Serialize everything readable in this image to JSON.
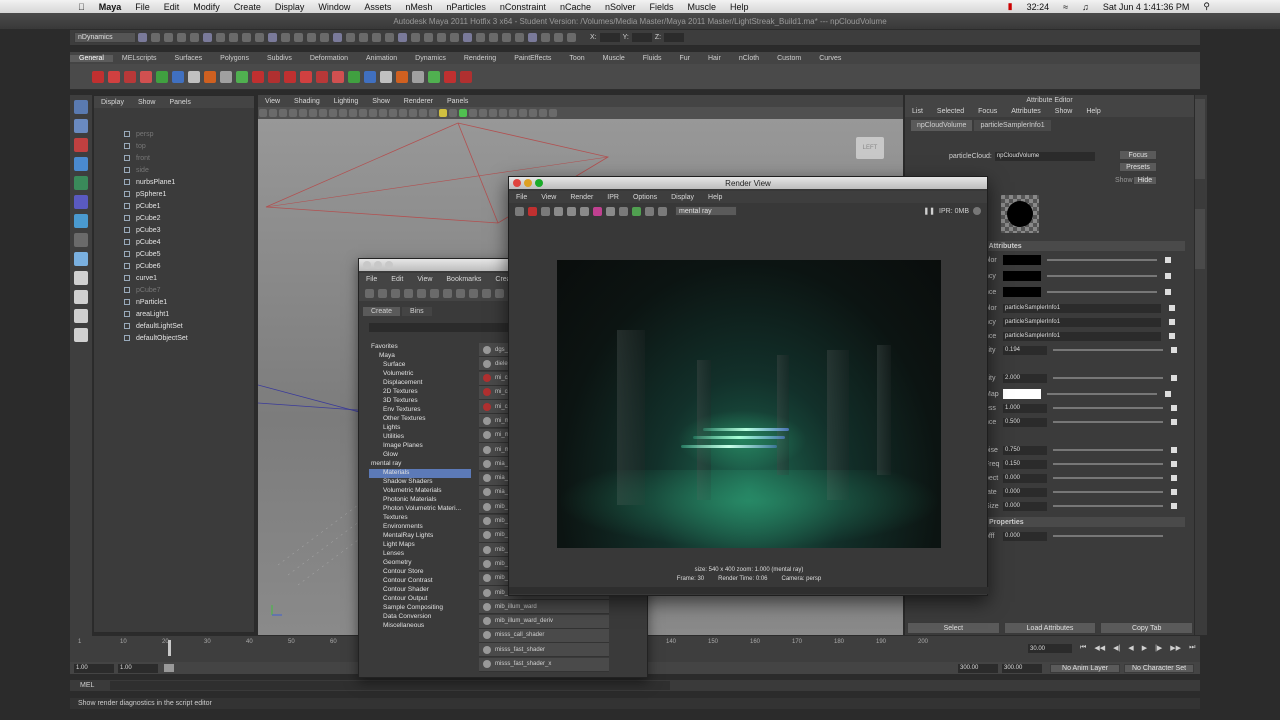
{
  "mac_menubar": {
    "app": "Maya",
    "items": [
      "File",
      "Edit",
      "Modify",
      "Create",
      "Display",
      "Window",
      "Assets",
      "nMesh",
      "nParticles",
      "nConstraint",
      "nCache",
      "nSolver",
      "Fields",
      "Muscle",
      "Help"
    ],
    "clock": "Sat Jun 4  1:41:36 PM",
    "battery_time": "32:24"
  },
  "window_title": "Autodesk Maya 2011 Hotfix 3 x64 - Student Version: /Volumes/Media Master/Maya 2011 Master/LightStreak_Build1.ma*  ---  npCloudVolume",
  "status_line": {
    "menu_set": "nDynamics",
    "x": "X:",
    "y": "Y:",
    "z": "Z:"
  },
  "shelf_tabs": [
    "General",
    "MELscripts",
    "Surfaces",
    "Polygons",
    "Subdivs",
    "Deformation",
    "Animation",
    "Dynamics",
    "Rendering",
    "PaintEffects",
    "Toon",
    "Muscle",
    "Fluids",
    "Fur",
    "Hair",
    "nCloth",
    "Custom",
    "Curves"
  ],
  "outliner": {
    "menu": [
      "Display",
      "Show",
      "Panels"
    ],
    "items": [
      {
        "label": "persp",
        "dim": true
      },
      {
        "label": "top",
        "dim": true
      },
      {
        "label": "front",
        "dim": true
      },
      {
        "label": "side",
        "dim": true
      },
      {
        "label": "nurbsPlane1",
        "dim": false
      },
      {
        "label": "pSphere1",
        "dim": false
      },
      {
        "label": "pCube1",
        "dim": false
      },
      {
        "label": "pCube2",
        "dim": false
      },
      {
        "label": "pCube3",
        "dim": false
      },
      {
        "label": "pCube4",
        "dim": false
      },
      {
        "label": "pCube5",
        "dim": false
      },
      {
        "label": "pCube6",
        "dim": false
      },
      {
        "label": "curve1",
        "dim": false
      },
      {
        "label": "pCube7",
        "dim": true
      },
      {
        "label": "nParticle1",
        "dim": false
      },
      {
        "label": "areaLight1",
        "dim": false
      },
      {
        "label": "defaultLightSet",
        "dim": false
      },
      {
        "label": "defaultObjectSet",
        "dim": false
      }
    ]
  },
  "viewport": {
    "menu": [
      "View",
      "Shading",
      "Lighting",
      "Show",
      "Renderer",
      "Panels"
    ],
    "view_cube": "LEFT"
  },
  "hypershade": {
    "menu": [
      "File",
      "Edit",
      "View",
      "Bookmarks",
      "Create",
      "T"
    ],
    "tabs": [
      "Create",
      "Bins"
    ],
    "tree": [
      {
        "label": "Favorites",
        "level": 0
      },
      {
        "label": "Maya",
        "level": 1
      },
      {
        "label": "Surface",
        "level": 2
      },
      {
        "label": "Volumetric",
        "level": 2
      },
      {
        "label": "Displacement",
        "level": 2
      },
      {
        "label": "2D Textures",
        "level": 2
      },
      {
        "label": "3D Textures",
        "level": 2
      },
      {
        "label": "Env Textures",
        "level": 2
      },
      {
        "label": "Other Textures",
        "level": 2
      },
      {
        "label": "Lights",
        "level": 2
      },
      {
        "label": "Utilities",
        "level": 2
      },
      {
        "label": "Image Planes",
        "level": 2
      },
      {
        "label": "Glow",
        "level": 2
      },
      {
        "label": "mental ray",
        "level": 0
      },
      {
        "label": "Materials",
        "level": 2,
        "selected": true
      },
      {
        "label": "Shadow Shaders",
        "level": 2
      },
      {
        "label": "Volumetric Materials",
        "level": 2
      },
      {
        "label": "Photonic Materials",
        "level": 2
      },
      {
        "label": "Photon Volumetric Materi...",
        "level": 2
      },
      {
        "label": "Textures",
        "level": 2
      },
      {
        "label": "Environments",
        "level": 2
      },
      {
        "label": "MentalRay Lights",
        "level": 2
      },
      {
        "label": "Light Maps",
        "level": 2
      },
      {
        "label": "Lenses",
        "level": 2
      },
      {
        "label": "Geometry",
        "level": 2
      },
      {
        "label": "Contour Store",
        "level": 2
      },
      {
        "label": "Contour Contrast",
        "level": 2
      },
      {
        "label": "Contour Shader",
        "level": 2
      },
      {
        "label": "Contour Output",
        "level": 2
      },
      {
        "label": "Sample Compositing",
        "level": 2
      },
      {
        "label": "Data Conversion",
        "level": 2
      },
      {
        "label": "Miscellaneous",
        "level": 2
      }
    ],
    "shaders": [
      "dgs_",
      "diele",
      "mi_ca",
      "mi_ca",
      "mi_ca",
      "mi_m",
      "mi_m",
      "mi_m",
      "mia_",
      "mia_",
      "mia_",
      "mib_",
      "mib_",
      "mib_",
      "mib_",
      "mib_",
      "mib_",
      "mib_",
      "mib_illum_ward",
      "mib_illum_ward_deriv",
      "misss_call_shader",
      "misss_fast_shader",
      "misss_fast_shader_x"
    ]
  },
  "render_view": {
    "title": "Render View",
    "menu": [
      "File",
      "View",
      "Render",
      "IPR",
      "Options",
      "Display",
      "Help"
    ],
    "camera_dropdown": "mental ray",
    "ipr": "IPR: 0MB",
    "info_line1": "size: 540 x 400  zoom: 1.000       (mental ray)",
    "info_line2_frame": "Frame: 30",
    "info_line2_time": "Render Time: 0:06",
    "info_line2_camera": "Camera: persp"
  },
  "attribute_editor": {
    "title": "Attribute Editor",
    "menu": [
      "List",
      "Selected",
      "Focus",
      "Attributes",
      "Show",
      "Help"
    ],
    "tabs": [
      "npCloudVolume",
      "particleSamplerInfo1"
    ],
    "node_label": "particleCloud:",
    "node_value": "npCloudVolume",
    "focus_btn": "Focus",
    "presets_btn": "Presets",
    "show_label": "Show",
    "hide_label": "Hide",
    "section1": "l Attributes",
    "rows": [
      {
        "label": "olor",
        "value": "",
        "swatch": "#000000"
      },
      {
        "label": "ncy",
        "value": "",
        "swatch": "#000000"
      },
      {
        "label": "nce",
        "value": "",
        "swatch": "#000000"
      },
      {
        "label": "olor",
        "value": "particleSamplerInfo1"
      },
      {
        "label": "ncy",
        "value": "particleSamplerInfo1"
      },
      {
        "label": "nce",
        "value": "particleSamplerInfo1"
      },
      {
        "label": "sity",
        "value": "0.194"
      },
      {
        "label": "sity",
        "value": "2.000"
      },
      {
        "label": "Map",
        "value": "",
        "swatch": "#ffffff"
      },
      {
        "label": "ess",
        "value": "1.000"
      },
      {
        "label": "nce",
        "value": "0.500"
      },
      {
        "label": "oise",
        "value": "0.750"
      },
      {
        "label": "Freq",
        "value": "0.150"
      },
      {
        "label": "pect",
        "value": "0.000"
      },
      {
        "label": "tate",
        "value": "0.000"
      },
      {
        "label": "Size",
        "value": "0.000"
      }
    ],
    "section2": "Properties",
    "falloff_label": "offf",
    "falloff_value": "0.000",
    "buttons": [
      "Select",
      "Load Attributes",
      "Copy Tab"
    ]
  },
  "timeline": {
    "ticks": [
      "1",
      "10",
      "20",
      "30",
      "40",
      "50",
      "60",
      "70",
      "80",
      "90",
      "100",
      "110",
      "120",
      "130",
      "140",
      "150",
      "160",
      "170",
      "180",
      "190",
      "200"
    ],
    "current_frame": "30.00",
    "range_start": "1.00",
    "range_start2": "1.00",
    "range_end": "300.00",
    "range_end2": "300.00",
    "anim_layer": "No Anim Layer",
    "char_set": "No Character Set"
  },
  "command_line": {
    "label": "MEL"
  },
  "help_line": "Show render diagnostics in the script editor"
}
